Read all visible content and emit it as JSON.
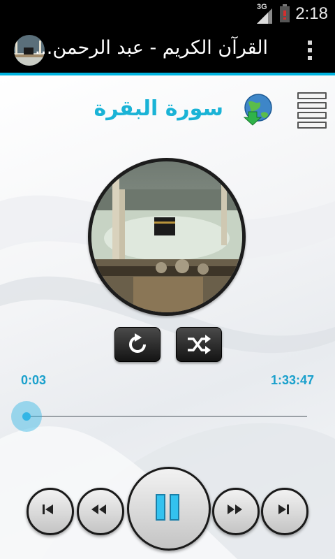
{
  "status_bar": {
    "network": "3G",
    "time": "2:18",
    "battery_level": 0.1
  },
  "action_bar": {
    "title": "القرآن الكريم - عبد الرحمن...",
    "logo_icon": "kaaba-logo-icon",
    "overflow_icon": "overflow-menu-icon",
    "accent_color": "#00b4e0"
  },
  "player": {
    "surah_name": "سورة البقرة",
    "download_icon": "globe-download-icon",
    "playlist_icon": "menu-list-icon",
    "artwork": "kaaba-mecca-image",
    "controls": {
      "repeat_icon": "repeat-icon",
      "shuffle_icon": "shuffle-icon"
    },
    "current_time": "0:03",
    "total_time": "1:33:47",
    "progress": 0.0005,
    "transport": {
      "previous_icon": "skip-previous-icon",
      "rewind_icon": "rewind-icon",
      "pause_icon": "pause-icon",
      "forward_icon": "fast-forward-icon",
      "next_icon": "skip-next-icon"
    },
    "accent_color": "#33b5e5"
  }
}
